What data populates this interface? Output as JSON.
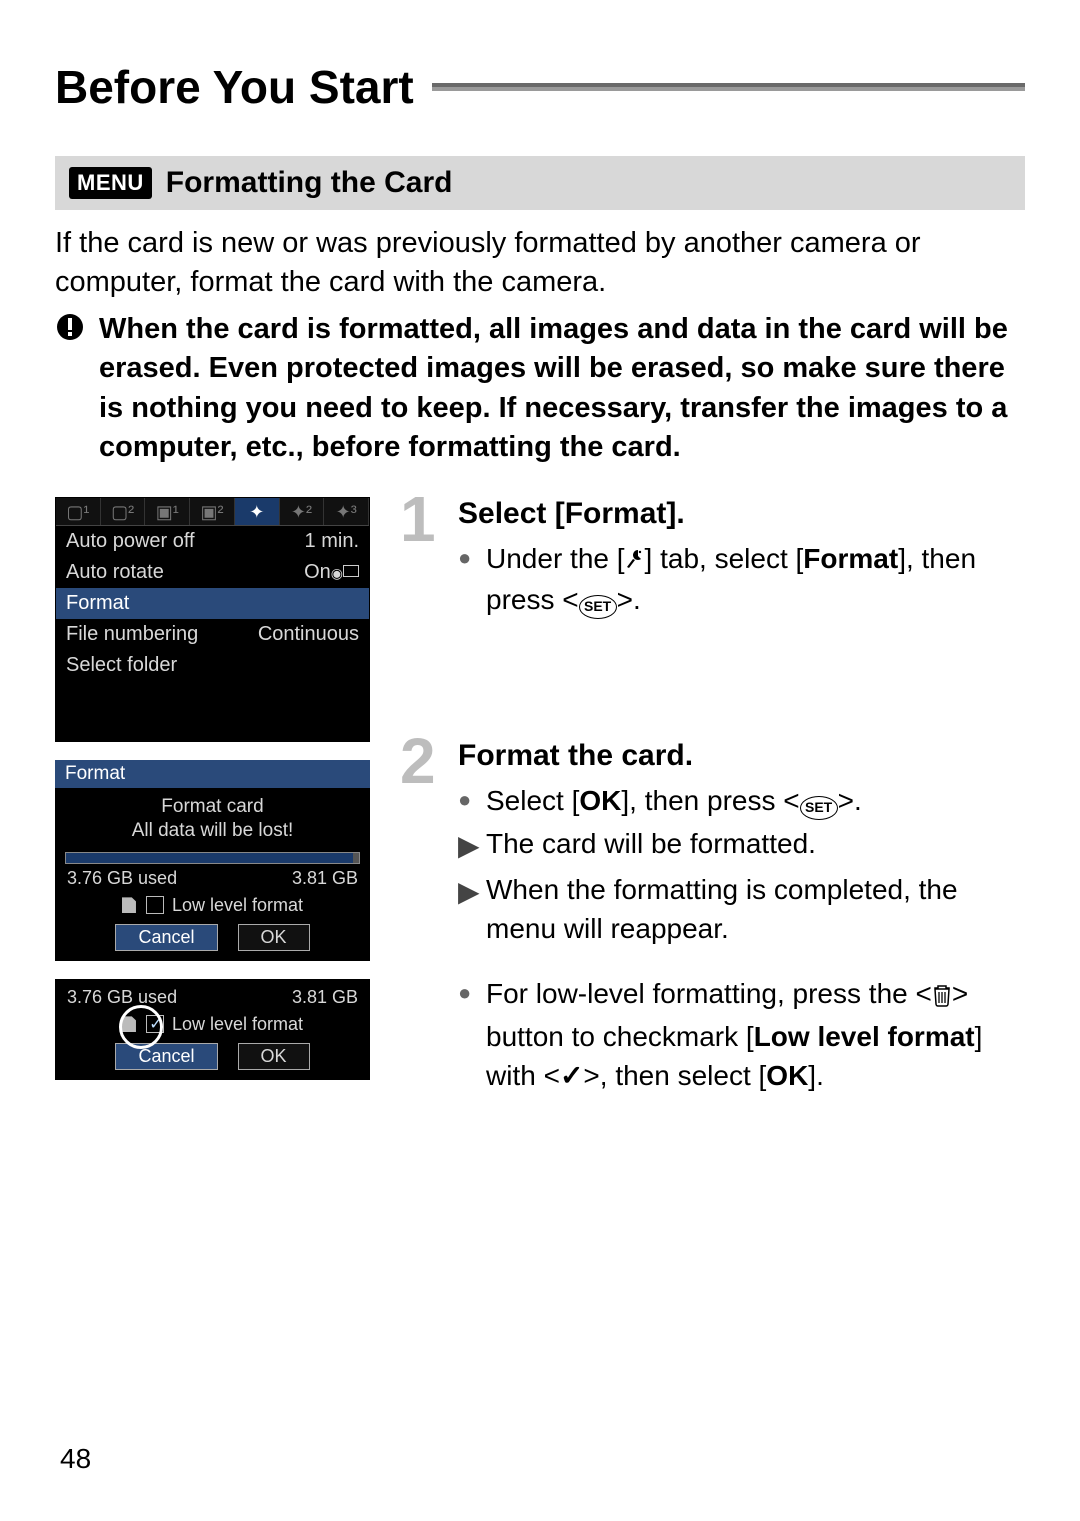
{
  "page_title": "Before You Start",
  "section_badge": "MENU",
  "section_title": "Formatting the Card",
  "intro": "If the card is new or was previously formatted by another camera or computer, format the card with the camera.",
  "warning": "When the card is formatted, all images and data in the card will be erased. Even protected images will be erased, so make sure there is nothing you need to keep. If necessary, transfer the images to a computer, etc., before formatting the card.",
  "menu_shot": {
    "rows": [
      {
        "label": "Auto power off",
        "value": "1 min."
      },
      {
        "label": "Auto rotate",
        "value": "On"
      },
      {
        "label": "Format",
        "value": "",
        "highlight": true
      },
      {
        "label": "File numbering",
        "value": "Continuous"
      },
      {
        "label": "Select folder",
        "value": ""
      }
    ]
  },
  "format_dialog": {
    "title": "Format",
    "line1": "Format card",
    "line2": "All data will be lost!",
    "used": "3.76 GB used",
    "total": "3.81 GB",
    "low_level": "Low level format",
    "cancel": "Cancel",
    "ok": "OK"
  },
  "steps": {
    "s1": {
      "num": "1",
      "title": "Select [Format].",
      "b1_pre": "Under the [",
      "b1_mid": "] tab, select [",
      "b1_bold": "Format",
      "b1_post": "], then press <",
      "b1_end": ">."
    },
    "s2": {
      "num": "2",
      "title": "Format the card.",
      "b1_pre": "Select [",
      "b1_bold": "OK",
      "b1_mid": "], then press <",
      "b1_end": ">.",
      "b2": "The card will be formatted.",
      "b3": "When the formatting is completed, the menu will reappear.",
      "b4_pre": "For low-level formatting, press the <",
      "b4_mid": "> button to checkmark [",
      "b4_bold": "Low level format",
      "b4_post": "] with <",
      "b4_end": ">, then select [",
      "b4_bold2": "OK",
      "b4_close": "]."
    }
  },
  "page_number": "48",
  "icons": {
    "set": "SET",
    "check": "✓"
  }
}
